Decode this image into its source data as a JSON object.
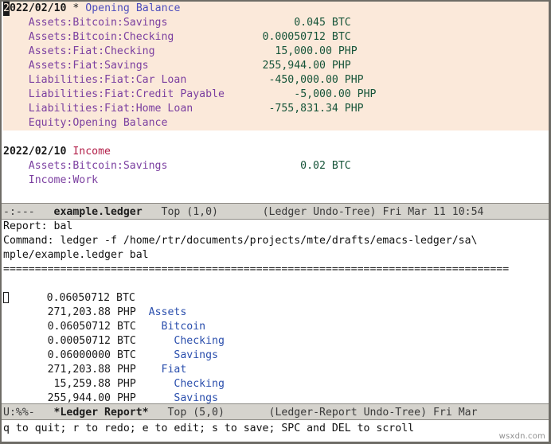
{
  "colors": {
    "xact_highlight_bg": "#fbe9da",
    "payee_blue": "#4d4dbd",
    "payee_red": "#b3204a",
    "account_purple": "#7b3fa0",
    "amount_green": "#17553a",
    "report_account_blue": "#2b4fad",
    "modeline_bg": "#d5d3cd",
    "frame_border": "#6e6c66",
    "background": "#ffffff"
  },
  "ledger_buffer": {
    "transactions": [
      {
        "date": "2022/02/10",
        "cursor_char": "2",
        "date_rest": "022/02/10",
        "marker": "*",
        "payee": "Opening Balance",
        "payee_color": "blue",
        "highlighted": true,
        "postings": [
          {
            "account": "Assets:Bitcoin:Savings",
            "amount": "0.045",
            "commodity": "BTC"
          },
          {
            "account": "Assets:Bitcoin:Checking",
            "amount": "0.00050712",
            "commodity": "BTC"
          },
          {
            "account": "Assets:Fiat:Checking",
            "amount": "15,000.00",
            "commodity": "PHP"
          },
          {
            "account": "Assets:Fiat:Savings",
            "amount": "255,944.00",
            "commodity": "PHP"
          },
          {
            "account": "Liabilities:Fiat:Car Loan",
            "amount": "-450,000.00",
            "commodity": "PHP"
          },
          {
            "account": "Liabilities:Fiat:Credit Payable",
            "amount": "-5,000.00",
            "commodity": "PHP"
          },
          {
            "account": "Liabilities:Fiat:Home Loan",
            "amount": "-755,831.34",
            "commodity": "PHP"
          },
          {
            "account": "Equity:Opening Balance",
            "amount": "",
            "commodity": ""
          }
        ]
      },
      {
        "date": "2022/02/10",
        "marker": "",
        "payee": "Income",
        "payee_color": "red",
        "highlighted": false,
        "postings": [
          {
            "account": "Assets:Bitcoin:Savings",
            "amount": "0.02",
            "commodity": "BTC"
          },
          {
            "account": "Income:Work",
            "amount": "",
            "commodity": ""
          }
        ]
      }
    ]
  },
  "ledger_modeline": {
    "status": "-:---",
    "buffer_name": "example.ledger",
    "position": "Top",
    "line_col": "(1,0)",
    "modes": "(Ledger Undo-Tree)",
    "clock": "Fri Mar 11 10:54"
  },
  "report_buffer": {
    "report_label": "Report:",
    "report_value": "bal",
    "command_label": "Command:",
    "command_line_1": "ledger -f /home/rtr/documents/projects/mte/drafts/emacs-ledger/sa\\",
    "command_line_2": "mple/example.ledger bal",
    "separator_char": "=",
    "rows": [
      {
        "amount": "0.06050712",
        "commodity": "BTC",
        "account": "",
        "indent": 0,
        "cursor": true
      },
      {
        "amount": "271,203.88",
        "commodity": "PHP",
        "account": "Assets",
        "indent": 0,
        "cursor": false
      },
      {
        "amount": "0.06050712",
        "commodity": "BTC",
        "account": "Bitcoin",
        "indent": 1,
        "cursor": false
      },
      {
        "amount": "0.00050712",
        "commodity": "BTC",
        "account": "Checking",
        "indent": 2,
        "cursor": false
      },
      {
        "amount": "0.06000000",
        "commodity": "BTC",
        "account": "Savings",
        "indent": 2,
        "cursor": false
      },
      {
        "amount": "271,203.88",
        "commodity": "PHP",
        "account": "Fiat",
        "indent": 1,
        "cursor": false
      },
      {
        "amount": "15,259.88",
        "commodity": "PHP",
        "account": "Checking",
        "indent": 2,
        "cursor": false
      },
      {
        "amount": "255,944.00",
        "commodity": "PHP",
        "account": "Savings",
        "indent": 2,
        "cursor": false
      }
    ]
  },
  "report_modeline": {
    "status": "U:%%-",
    "buffer_name": "*Ledger Report*",
    "position": "Top",
    "line_col": "(5,0)",
    "modes": "(Ledger-Report Undo-Tree)",
    "clock": "Fri Mar"
  },
  "echo_area": {
    "message": "q to quit; r to redo; e to edit; s to save; SPC and DEL to scroll"
  },
  "watermark": {
    "text": "wsxdn.com"
  }
}
